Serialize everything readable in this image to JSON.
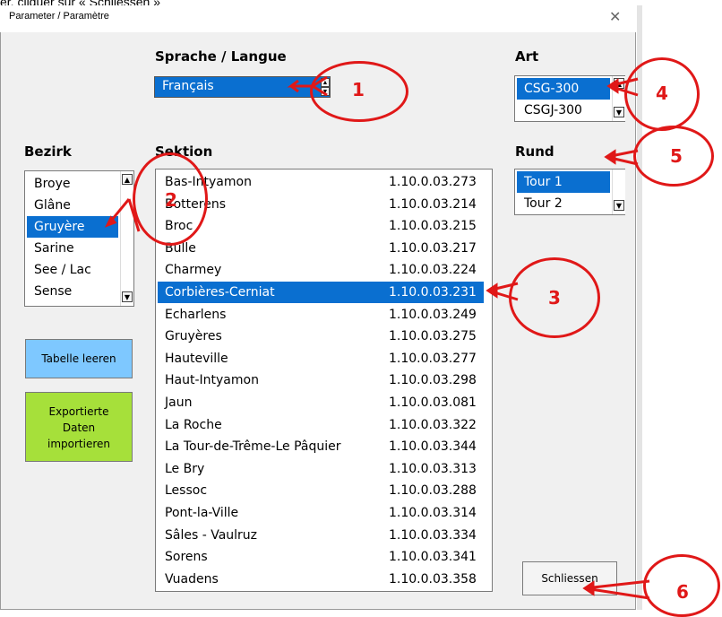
{
  "top_caption": "er, cliquer sur « Schliessen »",
  "window": {
    "title": "Parameter / Paramètre",
    "close_glyph": "✕"
  },
  "labels": {
    "sprache": "Sprache / Langue",
    "art": "Art",
    "bezirk": "Bezirk",
    "sektion": "Sektion",
    "rund": "Rund"
  },
  "sprache_value": "Français",
  "art_items": [
    "CSG-300",
    "CSGJ-300"
  ],
  "art_selected": "CSG-300",
  "rund_items": [
    "Tour 1",
    "Tour 2"
  ],
  "rund_selected": "Tour 1",
  "bezirk_items": [
    "Broye",
    "Glâne",
    "Gruyère",
    "Sarine",
    "See / Lac",
    "Sense"
  ],
  "bezirk_selected": "Gruyère",
  "sektion_rows": [
    {
      "name": "Bas-Intyamon",
      "code": "1.10.0.03.273"
    },
    {
      "name": "Botterens",
      "code": "1.10.0.03.214"
    },
    {
      "name": "Broc",
      "code": "1.10.0.03.215"
    },
    {
      "name": "Bulle",
      "code": "1.10.0.03.217"
    },
    {
      "name": "Charmey",
      "code": "1.10.0.03.224"
    },
    {
      "name": "Corbières-Cerniat",
      "code": "1.10.0.03.231"
    },
    {
      "name": "Echarlens",
      "code": "1.10.0.03.249"
    },
    {
      "name": "Gruyères",
      "code": "1.10.0.03.275"
    },
    {
      "name": "Hauteville",
      "code": "1.10.0.03.277"
    },
    {
      "name": "Haut-Intyamon",
      "code": "1.10.0.03.298"
    },
    {
      "name": "Jaun",
      "code": "1.10.0.03.081"
    },
    {
      "name": "La Roche",
      "code": "1.10.0.03.322"
    },
    {
      "name": "La Tour-de-Trême-Le Pâquier",
      "code": "1.10.0.03.344"
    },
    {
      "name": "Le Bry",
      "code": "1.10.0.03.313"
    },
    {
      "name": "Lessoc",
      "code": "1.10.0.03.288"
    },
    {
      "name": "Pont-la-Ville",
      "code": "1.10.0.03.314"
    },
    {
      "name": "Sâles - Vaulruz",
      "code": "1.10.0.03.334"
    },
    {
      "name": "Sorens",
      "code": "1.10.0.03.341"
    },
    {
      "name": "Vuadens",
      "code": "1.10.0.03.358"
    }
  ],
  "sektion_selected": "Corbières-Cerniat",
  "buttons": {
    "tabelle": "Tabelle leeren",
    "export_line1": "Exportierte",
    "export_line2": "Daten",
    "export_line3": "importieren",
    "schliessen": "Schliessen"
  },
  "callouts": [
    "1",
    "2",
    "3",
    "4",
    "5",
    "6"
  ],
  "colors": {
    "selection": "#0a6fd0",
    "tabelle_btn": "#7ec8ff",
    "export_btn": "#a6e03a",
    "callout": "#e01818"
  }
}
